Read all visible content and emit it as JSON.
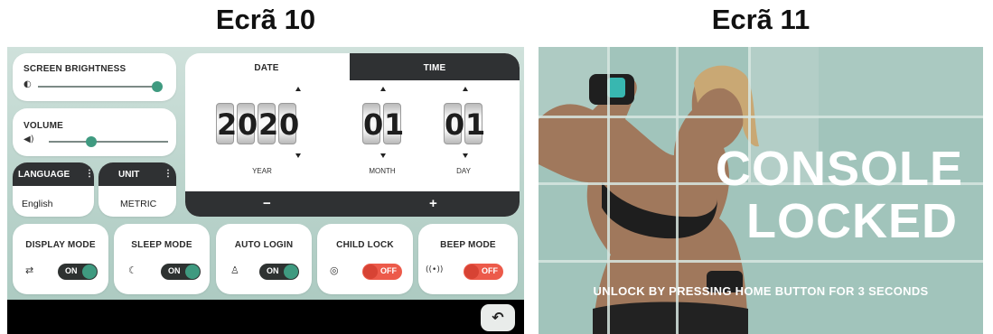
{
  "screen10": {
    "title": "Ecrã 10",
    "brightness": {
      "label": "SCREEN BRIGHTNESS",
      "icon": "brightness-icon",
      "level": 1.0
    },
    "volume": {
      "label": "VOLUME",
      "icon": "speaker-icon",
      "level": 0.35
    },
    "language": {
      "label": "LANGUAGE",
      "value": "English"
    },
    "unit": {
      "label": "UNIT",
      "value": "METRIC"
    },
    "datetime": {
      "tab_date": "DATE",
      "tab_time": "TIME",
      "year_digits": [
        "2",
        "0",
        "2",
        "0"
      ],
      "month_digits": [
        "0",
        "1"
      ],
      "day_digits": [
        "0",
        "1"
      ],
      "year_label": "YEAR",
      "month_label": "MONTH",
      "day_label": "DAY",
      "minus": "−",
      "plus": "+"
    },
    "modes": [
      {
        "label": "DISPLAY MODE",
        "icon": "display-mode-icon",
        "glyph": "⇄",
        "state": "ON",
        "on": true
      },
      {
        "label": "SLEEP MODE",
        "icon": "sleep-mode-icon",
        "glyph": "☾",
        "state": "ON",
        "on": true
      },
      {
        "label": "AUTO LOGIN",
        "icon": "user-icon",
        "glyph": "♙",
        "state": "ON",
        "on": true
      },
      {
        "label": "CHILD LOCK",
        "icon": "child-lock-icon",
        "glyph": "◎",
        "state": "OFF",
        "on": false
      },
      {
        "label": "BEEP MODE",
        "icon": "beep-icon",
        "glyph": "((•))",
        "state": "OFF",
        "on": false
      }
    ],
    "back_icon": "back-arrow-icon",
    "accent_color": "#3f9a80",
    "off_color": "#ec5a4a"
  },
  "screen11": {
    "title": "Ecrã 11",
    "headline_line1": "CONSOLE",
    "headline_line2": "LOCKED",
    "subtext": "UNLOCK BY PRESSING HOME BUTTON FOR 3 SECONDS",
    "background_color": "#a1c4bb"
  }
}
